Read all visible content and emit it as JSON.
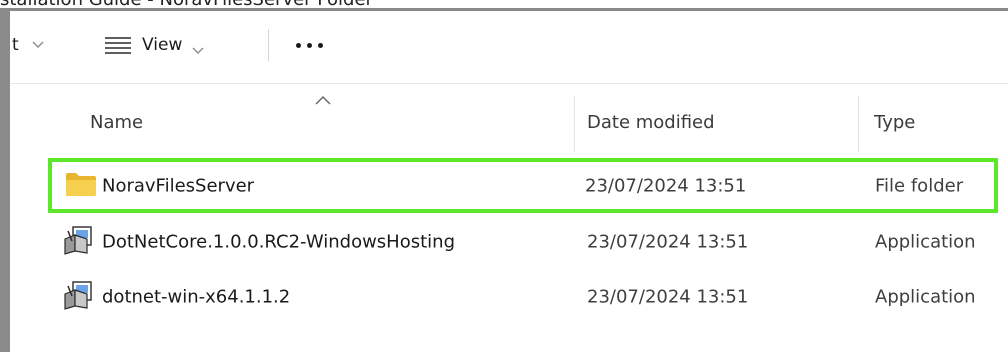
{
  "caption": "stallation Guide - NoravFilesServer Folder",
  "toolbar": {
    "truncated_label": "t",
    "view_label": "View",
    "more_icon": "more-dots-icon",
    "chevron_icon": "chevron-down-icon"
  },
  "columns": {
    "name": "Name",
    "date_modified": "Date modified",
    "type": "Type",
    "sort_indicator": "sort-ascending-icon"
  },
  "rows": [
    {
      "name": "NoravFilesServer",
      "date_modified": "23/07/2024 13:51",
      "type": "File folder",
      "icon": "folder-icon",
      "highlighted": true
    },
    {
      "name": "DotNetCore.1.0.0.RC2-WindowsHosting",
      "date_modified": "23/07/2024 13:51",
      "type": "Application",
      "icon": "installer-icon",
      "highlighted": false
    },
    {
      "name": "dotnet-win-x64.1.1.2",
      "date_modified": "23/07/2024 13:51",
      "type": "Application",
      "icon": "installer-icon",
      "highlighted": false
    }
  ],
  "colors": {
    "highlight_outline": "#5ce62c",
    "folder": "#f3c842",
    "window_border": "#8a8a8a"
  }
}
